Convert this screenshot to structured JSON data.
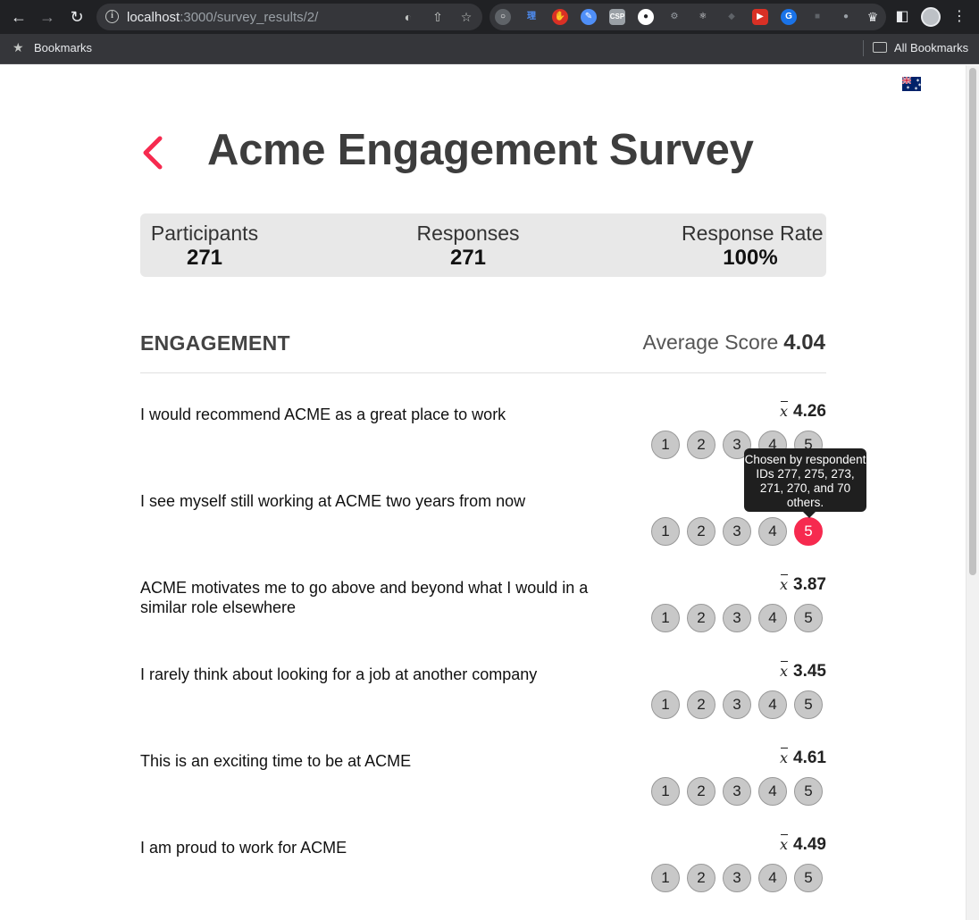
{
  "browser": {
    "url_host": "localhost",
    "url_rest": ":3000/survey_results/2/",
    "bookmarks_label": "Bookmarks",
    "all_bookmarks_label": "All Bookmarks"
  },
  "page": {
    "title": "Acme Engagement Survey"
  },
  "stats": {
    "participants_label": "Participants",
    "participants_value": "271",
    "responses_label": "Responses",
    "responses_value": "271",
    "rate_label": "Response Rate",
    "rate_value": "100%"
  },
  "section": {
    "title": "ENGAGEMENT",
    "avg_label": "Average Score",
    "avg_value": "4.04"
  },
  "questions": [
    {
      "text": "I would recommend ACME as a great place to work",
      "mean": "4.26"
    },
    {
      "text": "I see myself still working at ACME two years from now",
      "mean": "",
      "selected_option": 5
    },
    {
      "text": "ACME motivates me to go above and beyond what I would in a similar role elsewhere",
      "mean": "3.87"
    },
    {
      "text": "I rarely think about looking for a job at another company",
      "mean": "3.45"
    },
    {
      "text": "This is an exciting time to be at ACME",
      "mean": "4.61"
    },
    {
      "text": "I am proud to work for ACME",
      "mean": "4.49"
    }
  ],
  "options": [
    "1",
    "2",
    "3",
    "4",
    "5"
  ],
  "tooltip": {
    "text": "Chosen by respondent IDs 277, 275, 273, 271, 270, and 70 others."
  },
  "colors": {
    "accent": "#f62a4f",
    "option_bg": "#c8c8c8",
    "stats_bg": "#e8e8e8"
  }
}
